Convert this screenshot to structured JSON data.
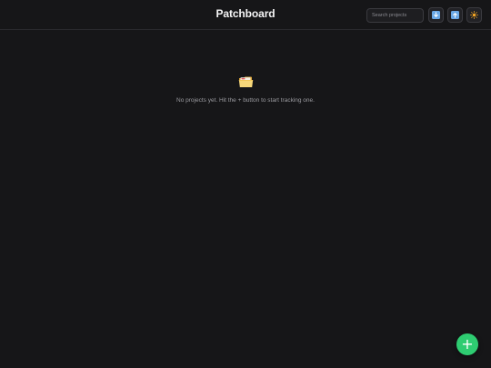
{
  "app": {
    "title": "Patchboard"
  },
  "header": {
    "search": {
      "placeholder": "Search projects",
      "value": ""
    },
    "buttons": [
      {
        "icon": "download-icon"
      },
      {
        "icon": "upload-icon"
      },
      {
        "icon": "sun-icon"
      }
    ]
  },
  "empty_state": {
    "icon": "folder-icon",
    "message": "No projects yet. Hit the + button to start tracking one."
  },
  "fab": {
    "label": "+",
    "icon": "plus-icon"
  },
  "colors": {
    "background": "#161618",
    "accent": "#2ecc71",
    "arrow_blue": "#6aa8e6",
    "sun_orange": "#f5a623"
  }
}
